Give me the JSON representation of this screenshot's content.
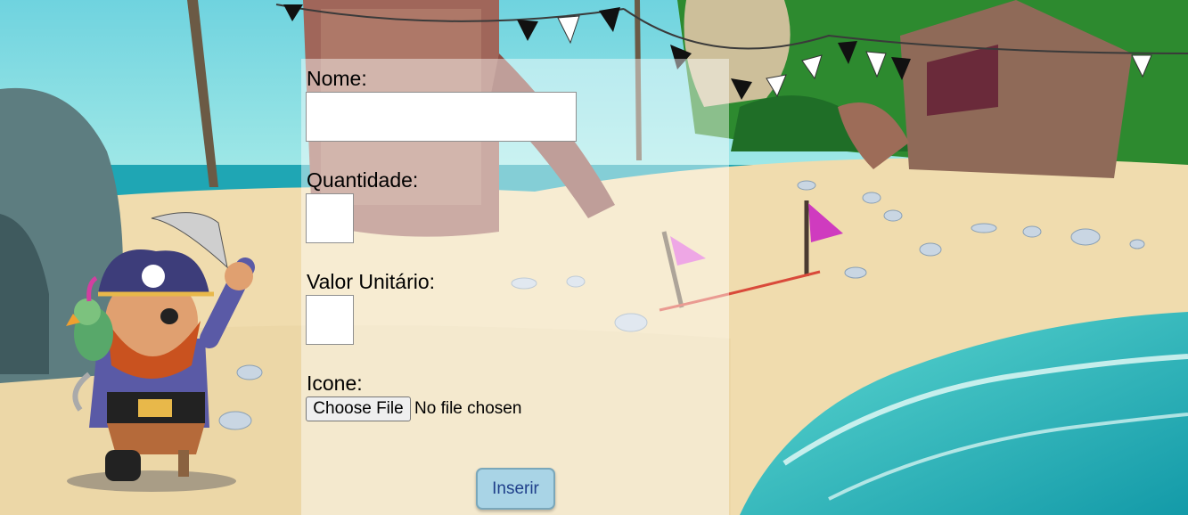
{
  "form": {
    "nome_label": "Nome:",
    "quantidade_label": "Quantidade:",
    "valor_label": "Valor Unitário:",
    "icone_label": "Icone:",
    "nome_value": "",
    "quantidade_value": "",
    "valor_value": "",
    "file_button_label": "Choose File",
    "file_status": "No file chosen",
    "submit_label": "Inserir"
  },
  "colors": {
    "sky": "#7fd8e0",
    "sand": "#efdcae",
    "sea": "#2ec2c4",
    "submit_bg": "#a9d4e6",
    "submit_text": "#1f3f8a"
  },
  "background": {
    "icons": [
      "pirate-icon",
      "parrot-icon",
      "shipwreck-icon",
      "pirate-flag-bunting-icon",
      "palm-tree-icon",
      "seashell-icon",
      "pink-flag-icon"
    ]
  }
}
